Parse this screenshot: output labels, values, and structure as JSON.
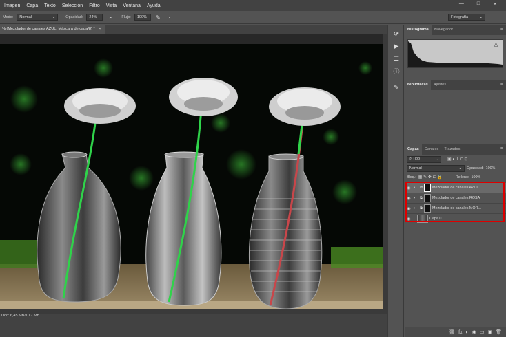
{
  "menu": {
    "items": [
      "Imagen",
      "Capa",
      "Texto",
      "Selección",
      "Filtro",
      "Vista",
      "Ventana",
      "Ayuda"
    ],
    "window_controls": [
      "—",
      "□",
      "✕"
    ]
  },
  "options": {
    "mode_label": "Modo:",
    "mode_value": "Normal",
    "opacity_label": "Opacidad:",
    "opacity_value": "24%",
    "flow_label": "Flujo:",
    "flow_value": "100%",
    "workspace": "Fotografía"
  },
  "document": {
    "tab_title": "% (Mezclador de canales AZUL, Máscara de capa/8) *",
    "close": "×",
    "status": "Doc: 6,45 MB/10,7 MB"
  },
  "panels": {
    "top_tabs": [
      "Histograma",
      "Navegador"
    ],
    "mid_tabs": [
      "Bibliotecas",
      "Ajustes"
    ],
    "layer_tabs": [
      "Capas",
      "Canales",
      "Trazados"
    ],
    "filter_label": "Tipo",
    "blend_mode": "Normal",
    "opacity_label": "Opacidad:",
    "opacity_value": "100%",
    "lock_label": "Bloq.:",
    "fill_label": "Relleno:",
    "fill_value": "100%",
    "layers": [
      {
        "name": "Mezclador de canales AZUL"
      },
      {
        "name": "Mezclador de canales ROSA"
      },
      {
        "name": "Mezclador de canales MOR..."
      },
      {
        "name": "Capa 0"
      }
    ],
    "bottom_icons": [
      "⛓",
      "fx",
      "◐",
      "◉",
      "▭",
      "▣",
      "🗑"
    ]
  },
  "colors": {
    "highlight": "#dd0000",
    "stem_green": "#2fd34a",
    "stem_pink": "#c8464a"
  }
}
